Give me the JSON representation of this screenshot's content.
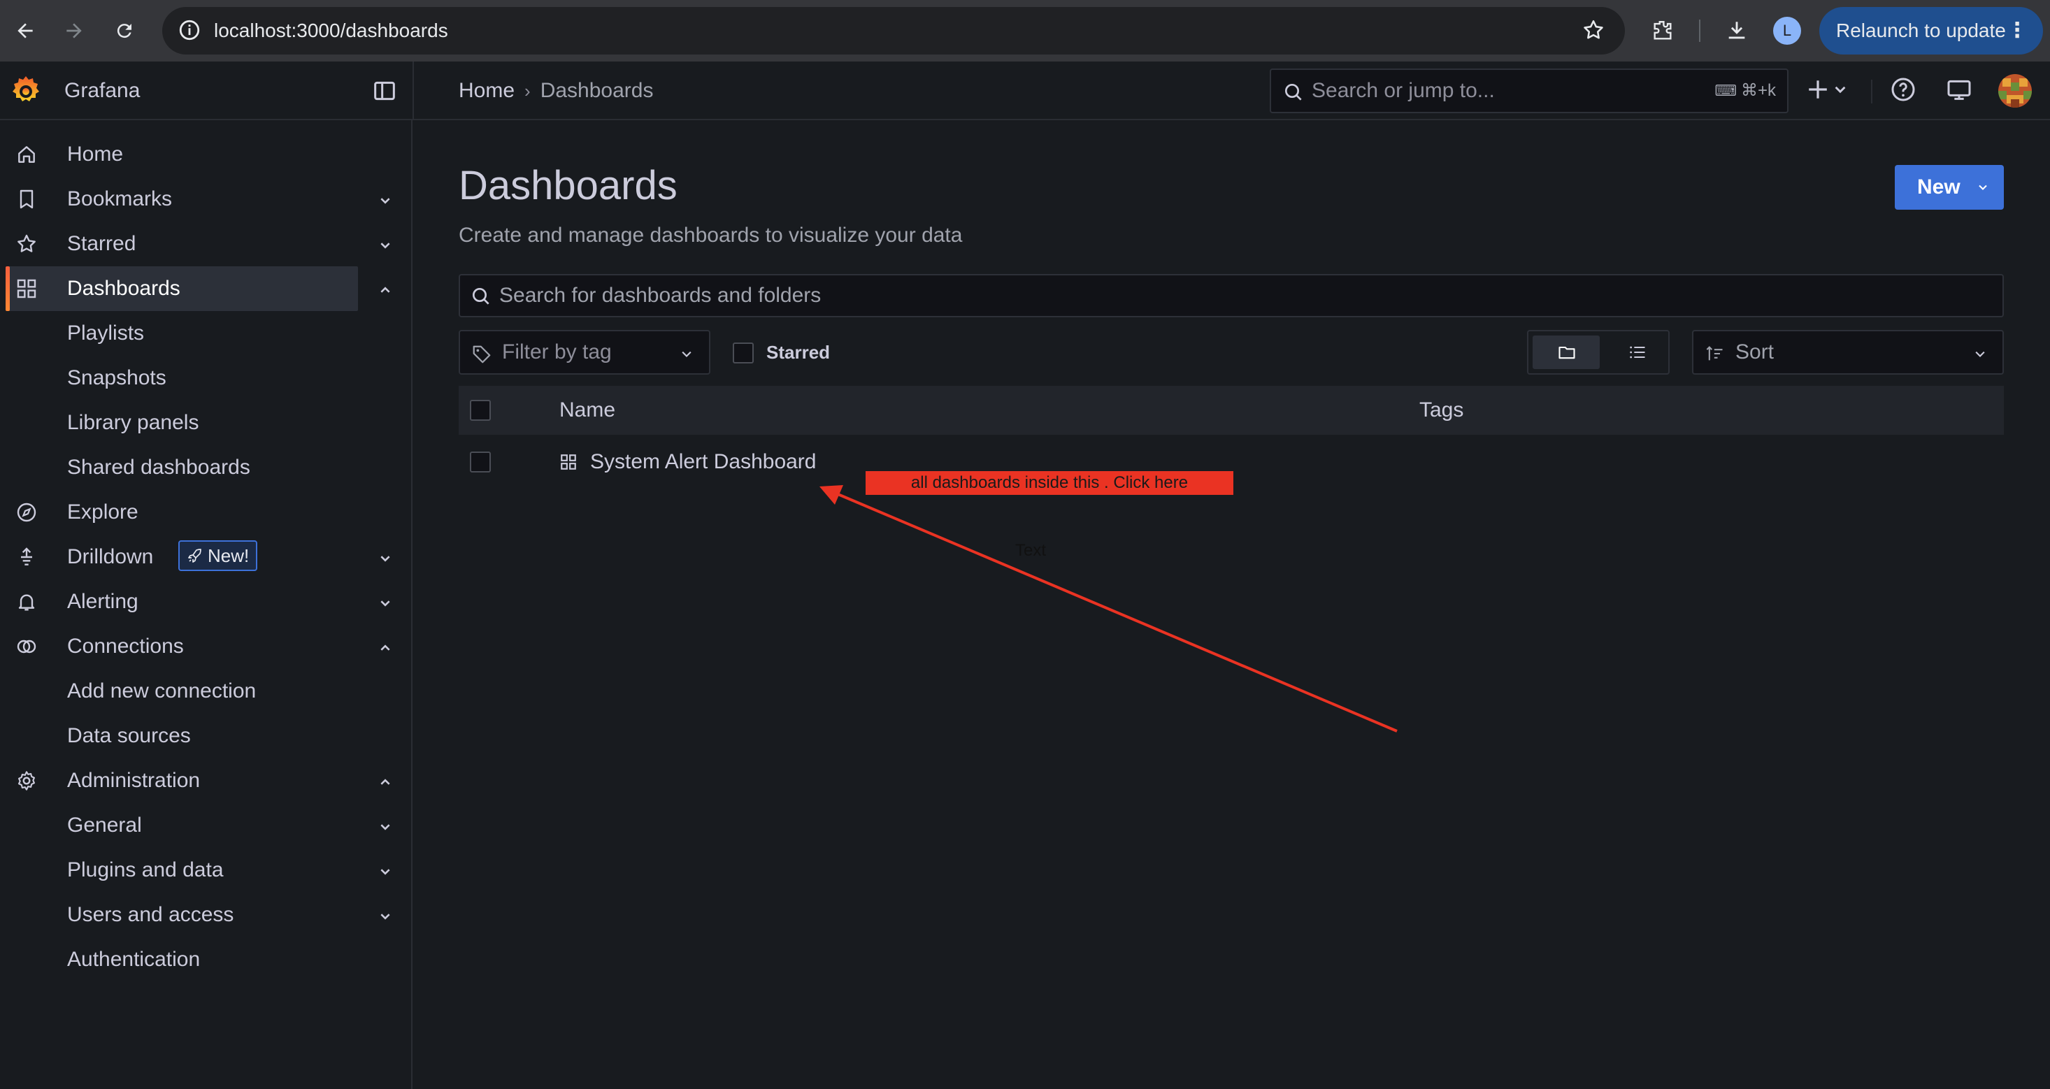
{
  "browser": {
    "url": "localhost:3000/dashboards",
    "profile_initial": "L",
    "relaunch_label": "Relaunch to update"
  },
  "topbar": {
    "app_name": "Grafana",
    "breadcrumb": [
      "Home",
      "Dashboards"
    ],
    "search_placeholder": "Search or jump to...",
    "search_shortcut": "⌘+k"
  },
  "sidebar": {
    "items": [
      {
        "label": "Home"
      },
      {
        "label": "Bookmarks"
      },
      {
        "label": "Starred"
      },
      {
        "label": "Dashboards",
        "active": true
      },
      {
        "label": "Playlists"
      },
      {
        "label": "Snapshots"
      },
      {
        "label": "Library panels"
      },
      {
        "label": "Shared dashboards"
      },
      {
        "label": "Explore"
      },
      {
        "label": "Drilldown",
        "badge": "New!"
      },
      {
        "label": "Alerting"
      },
      {
        "label": "Connections"
      },
      {
        "label": "Add new connection"
      },
      {
        "label": "Data sources"
      },
      {
        "label": "Administration"
      },
      {
        "label": "General"
      },
      {
        "label": "Plugins and data"
      },
      {
        "label": "Users and access"
      },
      {
        "label": "Authentication"
      }
    ]
  },
  "main": {
    "title": "Dashboards",
    "subtitle": "Create and manage dashboards to visualize your data",
    "new_button": "New",
    "search_placeholder": "Search for dashboards and folders",
    "tag_filter_placeholder": "Filter by tag",
    "starred_label": "Starred",
    "sort_placeholder": "Sort",
    "table": {
      "columns": [
        "Name",
        "Tags"
      ],
      "rows": [
        {
          "name": "System Alert Dashboard",
          "tags": ""
        }
      ]
    }
  },
  "annotation": {
    "callout": "all dashboards inside this . Click here",
    "text": "Text"
  },
  "colors": {
    "accent_blue": "#3d71d9",
    "active_indicator": "#f55f3e",
    "annotation_red": "#ea3323",
    "background": "#181b1f"
  }
}
